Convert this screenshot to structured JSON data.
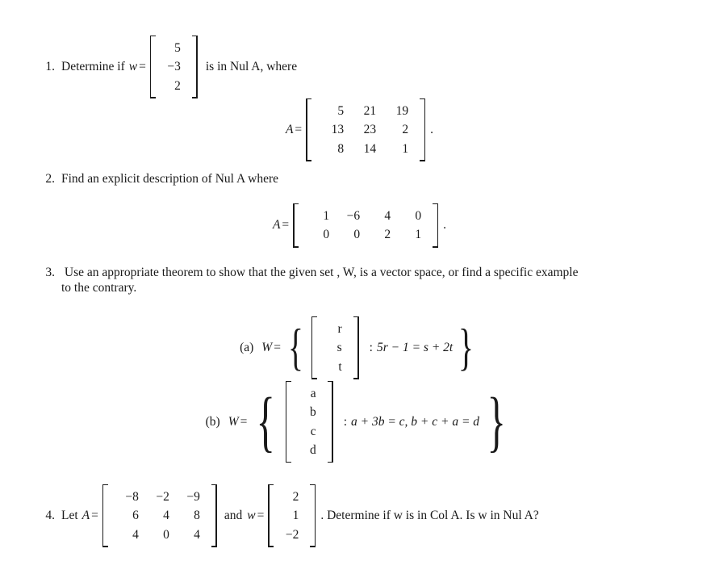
{
  "document": {
    "type": "math-problem-set",
    "subject": "Linear Algebra"
  },
  "problems": [
    {
      "number": "1.",
      "text_before": "Determine if",
      "var_w": "w",
      "equals": "=",
      "text_after": "is in Nul A, where",
      "vector": {
        "name": "w",
        "rows": [
          [
            "5"
          ],
          [
            "−3"
          ],
          [
            "2"
          ]
        ]
      },
      "display_matrix": {
        "name": "A",
        "equals": "=",
        "rows": [
          [
            "5",
            "21",
            "19"
          ],
          [
            "13",
            "23",
            "2"
          ],
          [
            "8",
            "14",
            "1"
          ]
        ],
        "trailing_punctuation": "."
      }
    },
    {
      "number": "2.",
      "text": "Find an explicit description of Nul A where",
      "display_matrix": {
        "name": "A",
        "equals": "=",
        "rows": [
          [
            "1",
            "−6",
            "4",
            "0"
          ],
          [
            "0",
            "0",
            "2",
            "1"
          ]
        ],
        "trailing_punctuation": "."
      }
    },
    {
      "number": "3.",
      "line1": "Use an appropriate theorem to show that the given set , W, is a vector space, or find a specific example",
      "line2": "to the contrary.",
      "parts": [
        {
          "label": "(a)",
          "set_name": "W",
          "equals": "=",
          "open_brace": "{",
          "close_brace": "}",
          "colon": ":",
          "vector_rows": [
            [
              "r"
            ],
            [
              "s"
            ],
            [
              "t"
            ]
          ],
          "condition": "5r − 1 = s + 2t"
        },
        {
          "label": "(b)",
          "set_name": "W",
          "equals": "=",
          "open_brace": "{",
          "close_brace": "}",
          "colon": ":",
          "vector_rows": [
            [
              "a"
            ],
            [
              "b"
            ],
            [
              "c"
            ],
            [
              "d"
            ]
          ],
          "condition": "a + 3b = c,  b + c + a = d"
        }
      ]
    },
    {
      "number": "4.",
      "text_let": "Let",
      "matrix_name": "A",
      "equals1": "=",
      "matrix_rows": [
        [
          "−8",
          "−2",
          "−9"
        ],
        [
          "6",
          "4",
          "8"
        ],
        [
          "4",
          "0",
          "4"
        ]
      ],
      "text_and": "and",
      "vector_name": "w",
      "equals2": "=",
      "vector_rows": [
        [
          "2"
        ],
        [
          "1"
        ],
        [
          "−2"
        ]
      ],
      "text_after": ". Determine if w is in Col A. Is w in Nul A?"
    }
  ],
  "colors": {
    "text": "#1a1a1a",
    "background": "#ffffff"
  }
}
